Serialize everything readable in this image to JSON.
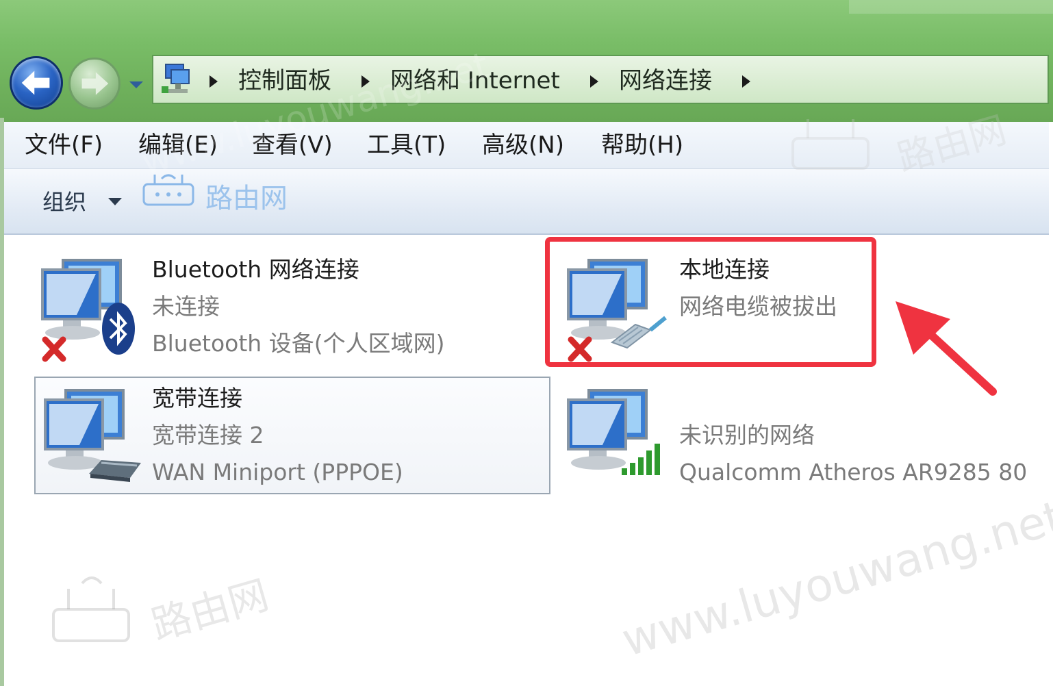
{
  "address_bar": {
    "crumbs": [
      "控制面板",
      "网络和 Internet",
      "网络连接"
    ]
  },
  "menu": {
    "items": [
      "文件(F)",
      "编辑(E)",
      "查看(V)",
      "工具(T)",
      "高级(N)",
      "帮助(H)"
    ]
  },
  "command_bar": {
    "organize": "组织"
  },
  "connections": [
    {
      "name": "Bluetooth 网络连接",
      "status": "未连接",
      "device": "Bluetooth 设备(个人区域网)"
    },
    {
      "name": "本地连接",
      "status": "网络电缆被拔出",
      "device": ""
    },
    {
      "name": "宽带连接",
      "status": "宽带连接  2",
      "device": "WAN Miniport (PPPOE)"
    },
    {
      "name": "",
      "status": "未识别的网络",
      "device": "Qualcomm Atheros AR9285 80"
    }
  ],
  "watermark": {
    "logo_text": "路由网",
    "url": "www.luyouwang.net"
  },
  "colors": {
    "highlight": "#ef3340",
    "titlebar_green": "#79bd67",
    "menu_bg": "#e6edf6"
  }
}
